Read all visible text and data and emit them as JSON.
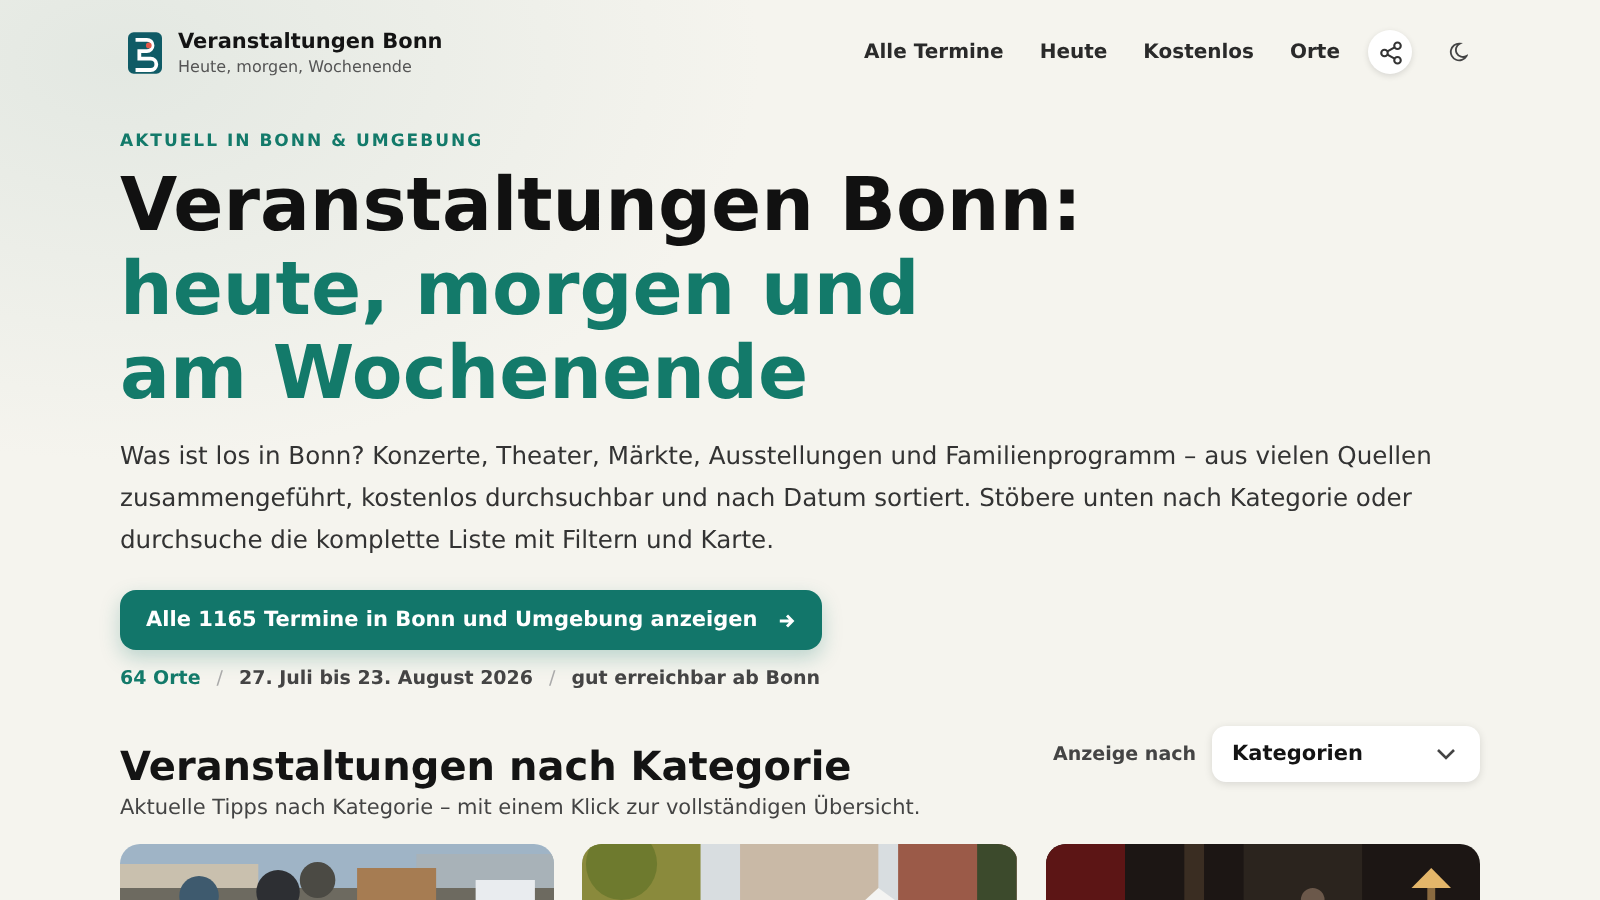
{
  "header": {
    "brand_title": "Veranstaltungen Bonn",
    "brand_subtitle": "Heute, morgen, Wochenende",
    "nav": [
      {
        "label": "Alle Termine"
      },
      {
        "label": "Heute"
      },
      {
        "label": "Kostenlos"
      },
      {
        "label": "Orte"
      }
    ]
  },
  "hero": {
    "kicker": "AKTUELL IN BONN & UMGEBUNG",
    "title_line": "Veranstaltungen Bonn:",
    "title_accent": "heute, morgen und am Wochenende",
    "intro": "Was ist los in Bonn? Konzerte, Theater, Märkte, Ausstellungen und Familienprogramm – aus vielen Quellen zusammengeführt, kostenlos durchsuchbar und nach Datum sortiert. Stöbere unten nach Kategorie oder durchsuche die komplette Liste mit Filtern und Karte.",
    "cta": "Alle 1165 Termine in Bonn und Umgebung anzeigen",
    "meta": [
      {
        "text": "64 Orte",
        "kind": "accent"
      },
      {
        "text": "/",
        "kind": "separator"
      },
      {
        "text": "27. Juli bis 23. August 2026",
        "kind": "plain"
      },
      {
        "text": "/",
        "kind": "separator"
      },
      {
        "text": "gut erreichbar ab Bonn",
        "kind": "plain"
      }
    ]
  },
  "categories": {
    "title": "Veranstaltungen nach Kategorie",
    "subtitle": "Aktuelle Tipps nach Kategorie – mit einem Klick zur vollständigen Übersicht.",
    "view_label": "Anzeige nach",
    "view_value": "Kategorien"
  }
}
